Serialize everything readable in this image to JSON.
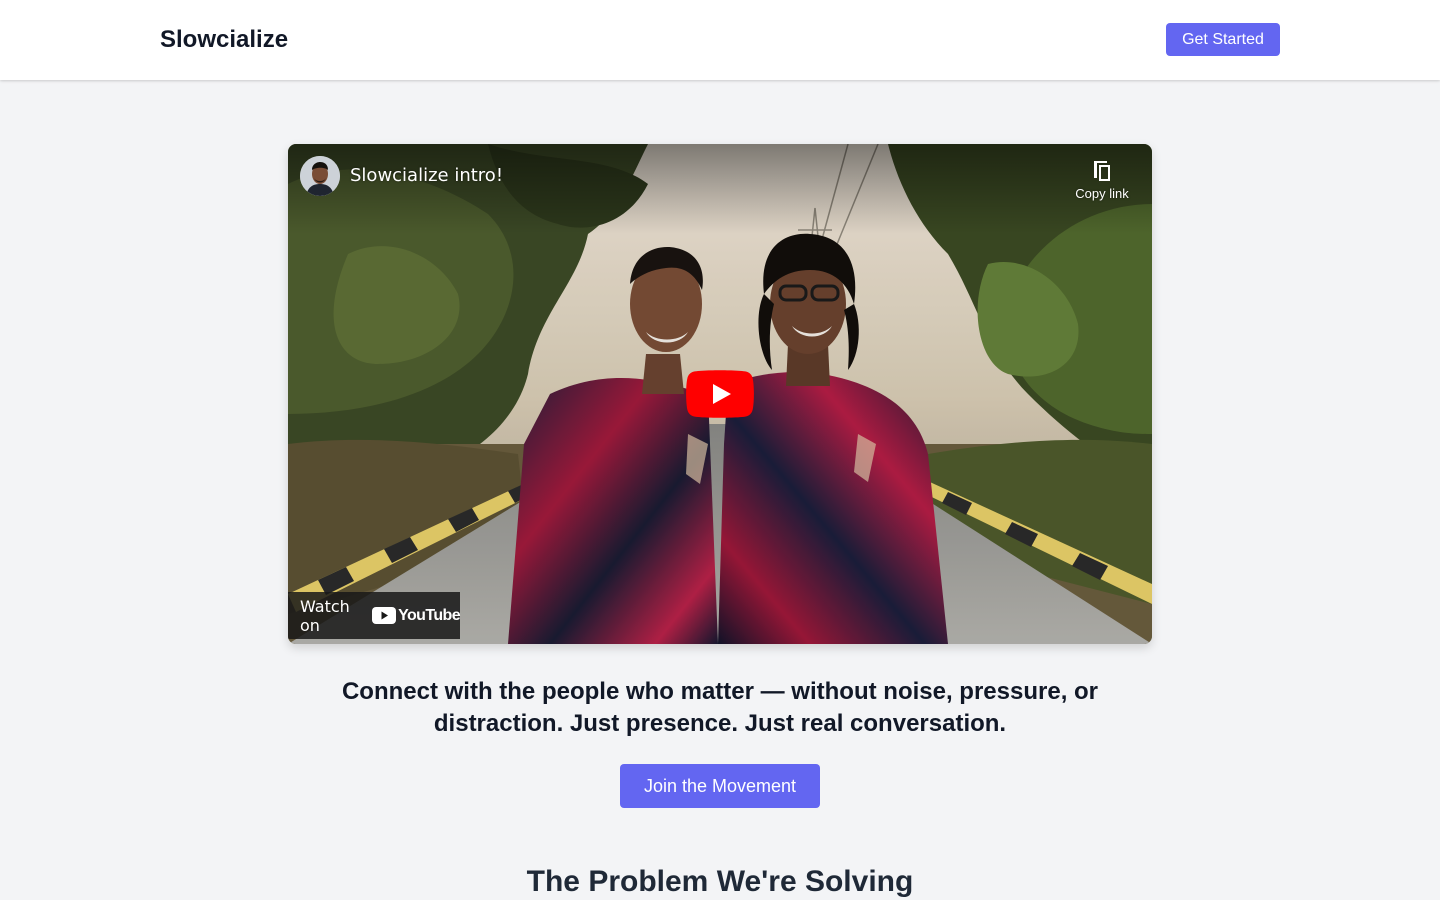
{
  "navbar": {
    "brand": "Slowcialize",
    "cta_label": "Get Started"
  },
  "video": {
    "title": "Slowcialize intro!",
    "copy_link_label": "Copy link",
    "watch_on_label": "Watch on",
    "youtube_wordmark": "YouTube",
    "icons": [
      "channel-avatar",
      "copy-icon",
      "play-icon",
      "youtube-logo-icon"
    ]
  },
  "hero": {
    "tagline": "Connect with the people who matter — without noise, pressure, or distraction. Just presence. Just real conversation.",
    "cta_label": "Join the Movement"
  },
  "problem_section": {
    "heading": "The Problem We're Solving"
  },
  "colors": {
    "accent": "#6366f1",
    "page_background": "#f3f4f6",
    "navbar_background": "#ffffff",
    "text_primary": "#111827",
    "youtube_red": "#ff0000"
  }
}
